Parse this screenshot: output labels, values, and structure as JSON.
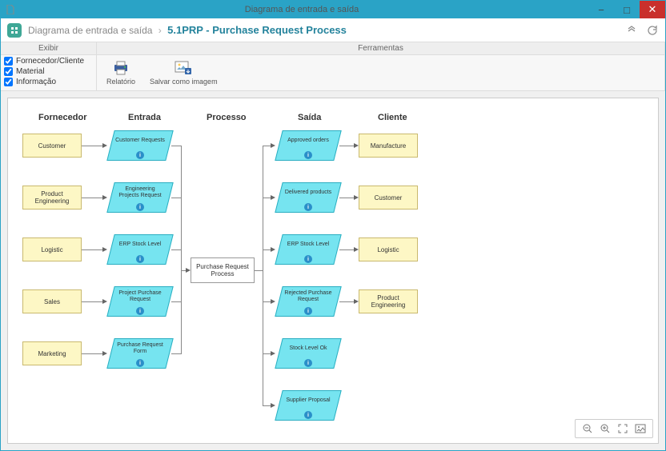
{
  "window": {
    "title": "Diagrama de entrada e saída"
  },
  "header": {
    "breadcrumb_parent": "Diagrama de entrada e saída",
    "breadcrumb_title": "5.1PRP - Purchase Request Process"
  },
  "toolbar": {
    "section_exibir": "Exibir",
    "section_ferramentas": "Ferramentas",
    "chk_fornecedor": "Fornecedor/Cliente",
    "chk_material": "Material",
    "chk_informacao": "Informação",
    "btn_relatorio": "Relatório",
    "btn_salvar_img": "Salvar como imagem"
  },
  "columns": {
    "fornecedor": "Fornecedor",
    "entrada": "Entrada",
    "processo": "Processo",
    "saida": "Saída",
    "cliente": "Cliente"
  },
  "process": {
    "label": "Purchase Request Process"
  },
  "suppliers": [
    {
      "label": "Customer"
    },
    {
      "label": "Product Engineering"
    },
    {
      "label": "Logistic"
    },
    {
      "label": "Sales"
    },
    {
      "label": "Marketing"
    }
  ],
  "inputs": [
    {
      "label": "Customer Requests"
    },
    {
      "label": "Engineering Projects Request"
    },
    {
      "label": "ERP Stock Level"
    },
    {
      "label": "Project Purchase Request"
    },
    {
      "label": "Purchase Request Form"
    }
  ],
  "outputs": [
    {
      "label": "Approved orders"
    },
    {
      "label": "Delivered products"
    },
    {
      "label": "ERP Stock Level"
    },
    {
      "label": "Rejected Purchase Request"
    },
    {
      "label": "Stock Level Ok"
    },
    {
      "label": "Supplier Proposal"
    }
  ],
  "clients": [
    {
      "label": "Manufacture"
    },
    {
      "label": "Customer"
    },
    {
      "label": "Logistic"
    },
    {
      "label": "Product Engineering"
    }
  ]
}
